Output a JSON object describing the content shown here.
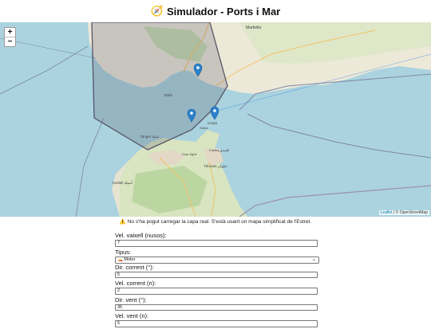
{
  "title": {
    "icon": "compass-icon",
    "text": "Simulador - Ports i Mar"
  },
  "map": {
    "zoom_in": "+",
    "zoom_out": "−",
    "labels": {
      "tarifa": "Tarifa",
      "tanger": "Tànger شتفا",
      "tetouan": "Tétouan تطوان",
      "assilah": "Assilah أصيلة",
      "marbella": "Marbella",
      "alcazarseguir": "Ksar es-Seghir",
      "fnideq": "Fnideq الفنيدق",
      "ceuta": "Ceuta",
      "sebta": "Sebta",
      "ksar": "Ksar Sghir"
    },
    "attribution_leaflet": "Leaflet",
    "attribution_rest": " | © OpenStreetMap"
  },
  "warning": {
    "icon": "warning-icon",
    "text": "No s'ha pogut carregar la capa real. S'està usant un mapa simplificat de l'Estret."
  },
  "form": {
    "speed_label": "Vel. vaixell (nusos):",
    "speed_value": "7",
    "type_label": "Tipus:",
    "type_value": "Motor",
    "current_dir_label": "Dir. corrent (°):",
    "current_dir_value": "5",
    "current_speed_label": "Vel. corrent (n):",
    "current_speed_value": "2",
    "wind_dir_label": "Dir. vent (°):",
    "wind_dir_value": "35",
    "wind_speed_label": "Vel. vent (n):",
    "wind_speed_value": "5"
  }
}
